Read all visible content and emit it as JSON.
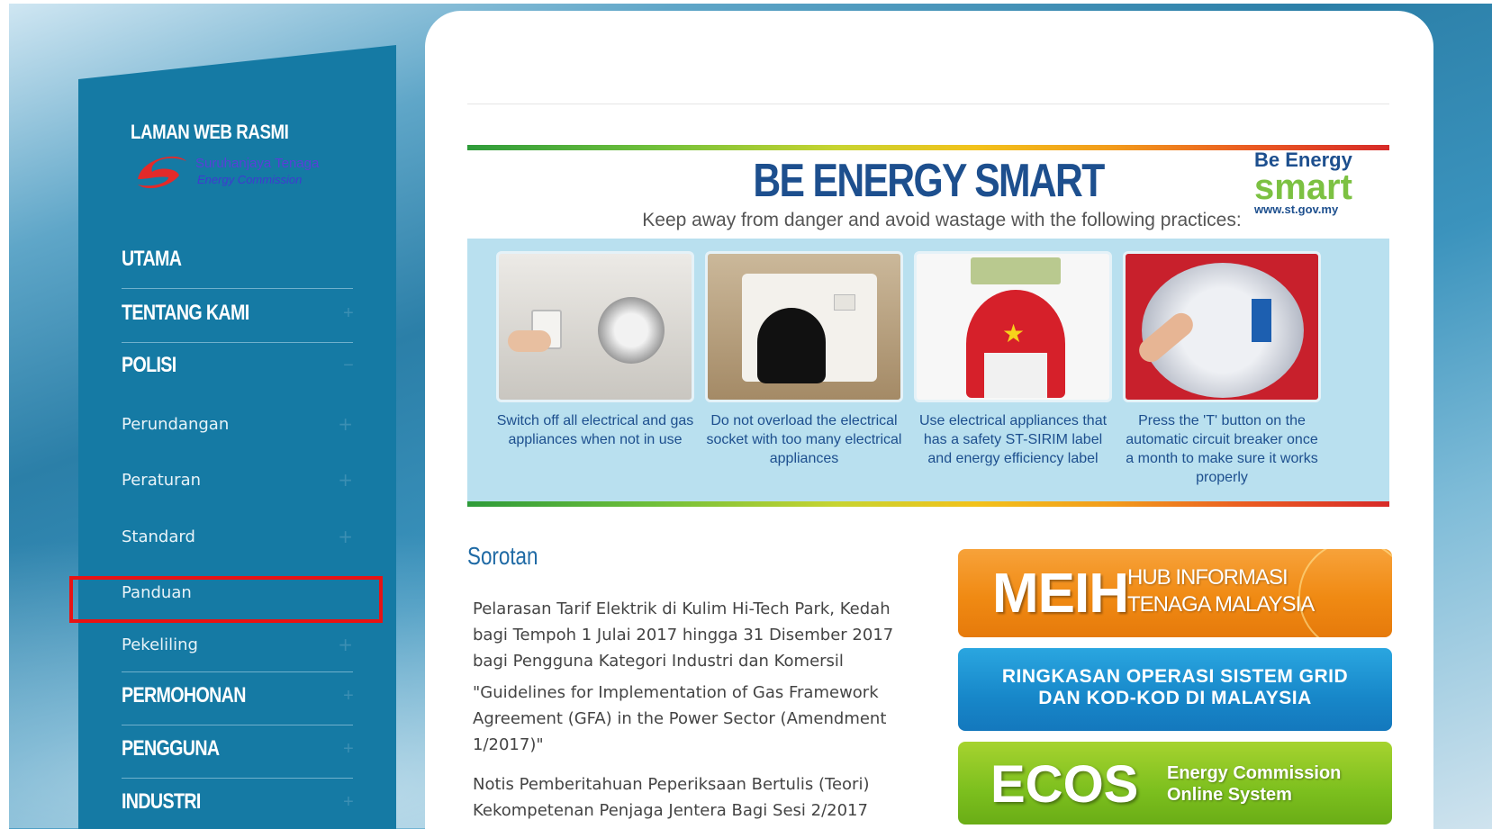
{
  "sidebar": {
    "site_title": "LAMAN WEB RASMI",
    "logo_line1": "Suruhanjaya Tenaga",
    "logo_line2": "Energy Commission",
    "items": [
      {
        "label": "UTAMA",
        "plus": ""
      },
      {
        "label": "TENTANG KAMI",
        "plus": "+"
      },
      {
        "label": "POLISI",
        "plus": "−"
      },
      {
        "label": "Perundangan",
        "plus": "+"
      },
      {
        "label": "Peraturan",
        "plus": "+"
      },
      {
        "label": "Standard",
        "plus": "+"
      },
      {
        "label": "Panduan",
        "plus": ""
      },
      {
        "label": "Pekeliling",
        "plus": "+"
      },
      {
        "label": "PERMOHONAN",
        "plus": "+"
      },
      {
        "label": "PENGGUNA",
        "plus": "+"
      },
      {
        "label": "INDUSTRI",
        "plus": "+"
      }
    ]
  },
  "banner": {
    "title": "BE ENERGY SMART",
    "subtitle": "Keep away from danger and avoid wastage with the following practices:",
    "logo_line1": "Be Energy",
    "logo_line2": "smart",
    "logo_url": "www.st.gov.my",
    "cards": [
      {
        "caption": "Switch off all electrical and gas appliances when not in use"
      },
      {
        "caption": "Do not overload the electrical socket with too many electrical appliances"
      },
      {
        "caption": "Use electrical appliances that has a safety ST-SIRIM label and energy efficiency label"
      },
      {
        "caption": "Press the 'T' button on the automatic circuit breaker once a month to make sure it works properly"
      }
    ]
  },
  "sorotan": {
    "heading": "Sorotan",
    "items": [
      "Pelarasan Tarif Elektrik di Kulim Hi-Tech Park, Kedah bagi Tempoh 1 Julai 2017 hingga 31 Disember 2017 bagi Pengguna Kategori Industri dan Komersil",
      "\"Guidelines for Implementation of Gas Framework Agreement (GFA) in the Power Sector (Amendment 1/2017)\"",
      "Notis Pemberitahuan Peperiksaan Bertulis (Teori) Kekompetenan Penjaga Jentera Bagi Sesi 2/2017"
    ]
  },
  "ads": {
    "meih_big": "MEIH",
    "meih_line1": "HUB INFORMASI",
    "meih_line2": "TENAGA MALAYSIA",
    "grid_line1": "RINGKASAN OPERASI SISTEM GRID",
    "grid_line2": "DAN KOD-KOD DI MALAYSIA",
    "ecos_big": "ECOS",
    "ecos_line1": "Energy Commission",
    "ecos_line2": "Online System"
  },
  "colors": {
    "sidebar": "#157aa4",
    "title_blue": "#1d4f8e",
    "highlight": "#e81313"
  }
}
